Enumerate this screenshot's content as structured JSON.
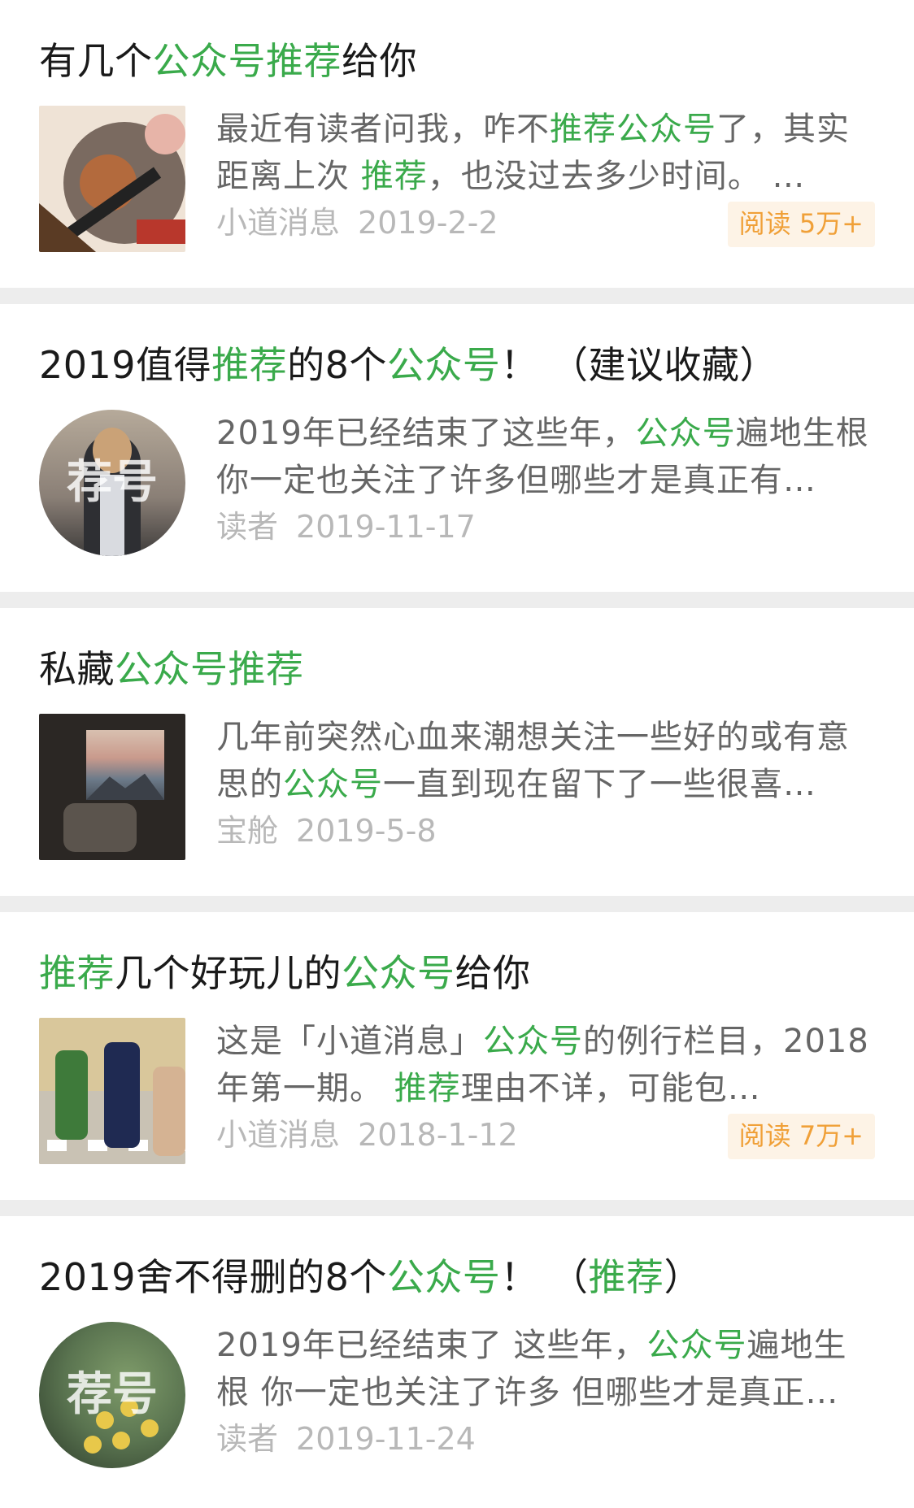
{
  "items": [
    {
      "title_parts": [
        {
          "text": "有几个",
          "hl": false
        },
        {
          "text": "公众号推荐",
          "hl": true
        },
        {
          "text": "给你",
          "hl": false
        }
      ],
      "snippet_parts": [
        {
          "text": "最近有读者问我，咋不",
          "hl": false
        },
        {
          "text": "推荐公众号",
          "hl": true
        },
        {
          "text": "了，其实距离上次 ",
          "hl": false
        },
        {
          "text": "推荐",
          "hl": true
        },
        {
          "text": "，也没过去多少时间。 …",
          "hl": false
        }
      ],
      "source": "小道消息",
      "date": "2019-2-2",
      "badge": "阅读 5万+",
      "thumb": "abstract-art-thumbnail"
    },
    {
      "title_parts": [
        {
          "text": "2019值得",
          "hl": false
        },
        {
          "text": "推荐",
          "hl": true
        },
        {
          "text": "的8个",
          "hl": false
        },
        {
          "text": "公众号",
          "hl": true
        },
        {
          "text": "！ （建议收藏）",
          "hl": false
        }
      ],
      "snippet_parts": [
        {
          "text": "2019年已经结束了这些年，",
          "hl": false
        },
        {
          "text": "公众号",
          "hl": true
        },
        {
          "text": "遍地生根你一定也关注了许多但哪些才是真正有…",
          "hl": false
        }
      ],
      "source": "读者",
      "date": "2019-11-17",
      "badge": "",
      "thumb": "avatar-person",
      "overlay": "荐号"
    },
    {
      "title_parts": [
        {
          "text": "私藏",
          "hl": false
        },
        {
          "text": "公众号推荐",
          "hl": true
        }
      ],
      "snippet_parts": [
        {
          "text": "几年前突然心血来潮想关注一些好的或有意思的",
          "hl": false
        },
        {
          "text": "公众号",
          "hl": true
        },
        {
          "text": "一直到现在留下了一些很喜…",
          "hl": false
        }
      ],
      "source": "宝舱",
      "date": "2019-5-8",
      "badge": "",
      "thumb": "room-window-thumbnail"
    },
    {
      "title_parts": [
        {
          "text": "推荐",
          "hl": true
        },
        {
          "text": "几个好玩儿的",
          "hl": false
        },
        {
          "text": "公众号",
          "hl": true
        },
        {
          "text": "给你",
          "hl": false
        }
      ],
      "snippet_parts": [
        {
          "text": "这是「小道消息」",
          "hl": false
        },
        {
          "text": "公众号",
          "hl": true
        },
        {
          "text": "的例行栏目，2018 年第一期。 ",
          "hl": false
        },
        {
          "text": "推荐",
          "hl": true
        },
        {
          "text": "理由不详，可能包…",
          "hl": false
        }
      ],
      "source": "小道消息",
      "date": "2018-1-12",
      "badge": "阅读 7万+",
      "thumb": "comic-thumbnail"
    },
    {
      "title_parts": [
        {
          "text": "2019舍不得删的8个",
          "hl": false
        },
        {
          "text": "公众号",
          "hl": true
        },
        {
          "text": "！ （",
          "hl": false
        },
        {
          "text": "推荐",
          "hl": true
        },
        {
          "text": "）",
          "hl": false
        }
      ],
      "snippet_parts": [
        {
          "text": "2019年已经结束了 这些年，",
          "hl": false
        },
        {
          "text": "公众号",
          "hl": true
        },
        {
          "text": "遍地生根 你一定也关注了许多 但哪些才是真正…",
          "hl": false
        }
      ],
      "source": "读者",
      "date": "2019-11-24",
      "badge": "",
      "thumb": "avatar-flowers",
      "overlay": "荐号"
    }
  ],
  "colors": {
    "highlight": "#3aaa4b",
    "meta": "#b8b8b8",
    "badge_bg": "#fdf3e6",
    "badge_fg": "#f0a038",
    "separator": "#ededed"
  }
}
